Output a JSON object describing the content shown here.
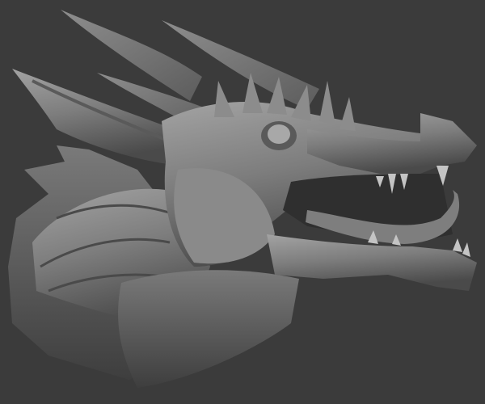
{
  "scene": {
    "subject": "dragon-head-sculpt",
    "colors": {
      "background": "#3b3b3b",
      "clay_light": "#9a9a9a",
      "clay_mid": "#7b7b7b",
      "clay_dark": "#4f4f4f",
      "clay_shadow": "#2e2e2e"
    }
  }
}
